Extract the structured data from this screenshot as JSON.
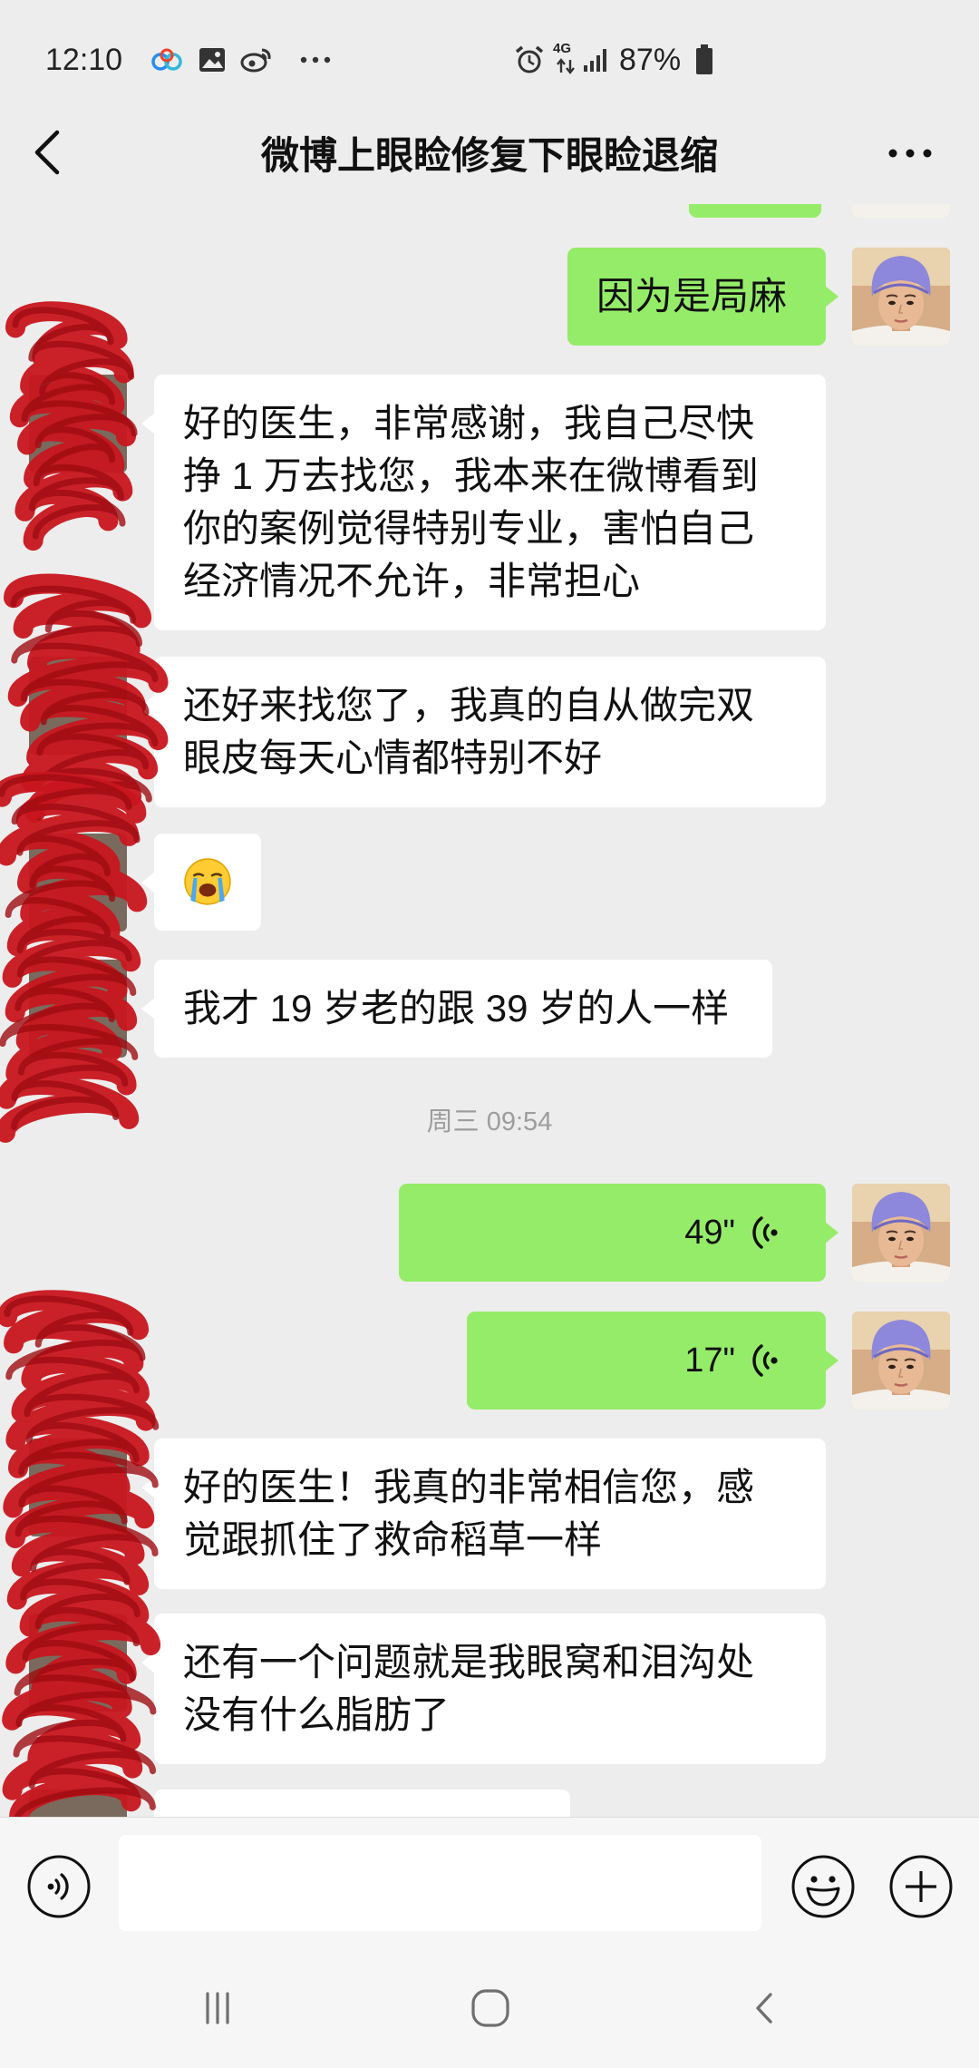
{
  "status_bar": {
    "time": "12:10",
    "left_icons": [
      "baidu-netdisk-icon",
      "gallery-icon",
      "weibo-icon",
      "more-notifications-icon"
    ],
    "right_icons": [
      "alarm-icon",
      "mobile-data-icon",
      "signal-icon",
      "battery-icon"
    ],
    "network_type": "4G",
    "battery": "87%"
  },
  "header": {
    "title": "微博上眼睑修复下眼睑退缩",
    "back_icon": "chevron-left-icon",
    "more_icon": "more-icon"
  },
  "chat": {
    "messages": [
      {
        "text": "因为是局麻"
      },
      {
        "lines": [
          "好的医生，非常感谢，我自己尽快",
          "挣 1 万去找您，我本来在微博看到",
          "你的案例觉得特别专业，害怕自己",
          "经济情况不允许，非常担心"
        ]
      },
      {
        "lines": [
          "还好来找您了，我真的自从做完双",
          "眼皮每天心情都特别不好"
        ]
      },
      {
        "emoji": "loudly-crying-face-icon"
      },
      {
        "text": "我才 19 岁老的跟 39 岁的人一样"
      },
      {
        "voice_duration": "49\""
      },
      {
        "voice_duration": "17\""
      },
      {
        "lines": [
          "好的医生！我真的非常相信您，感",
          "觉跟抓住了救命稻草一样"
        ]
      },
      {
        "lines": [
          "还有一个问题就是我眼窝和泪沟处",
          "没有什么脂肪了"
        ]
      }
    ],
    "timestamp": "周三 09:54",
    "voice_icon": "voice-wave-icon",
    "avatar_icon": "doctor-avatar"
  },
  "input_bar": {
    "voice_icon": "voice-input-icon",
    "input_value": "",
    "emoji_icon": "emoji-icon",
    "plus_icon": "plus-icon"
  },
  "nav_bar": {
    "icons": [
      "recent-apps-icon",
      "home-icon",
      "back-icon"
    ]
  },
  "colors": {
    "background": "#ededed",
    "outgoing_bubble": "#95ec69",
    "incoming_bubble": "#ffffff",
    "scribble": "#c8161d",
    "timestamp": "#9d9d9d"
  }
}
